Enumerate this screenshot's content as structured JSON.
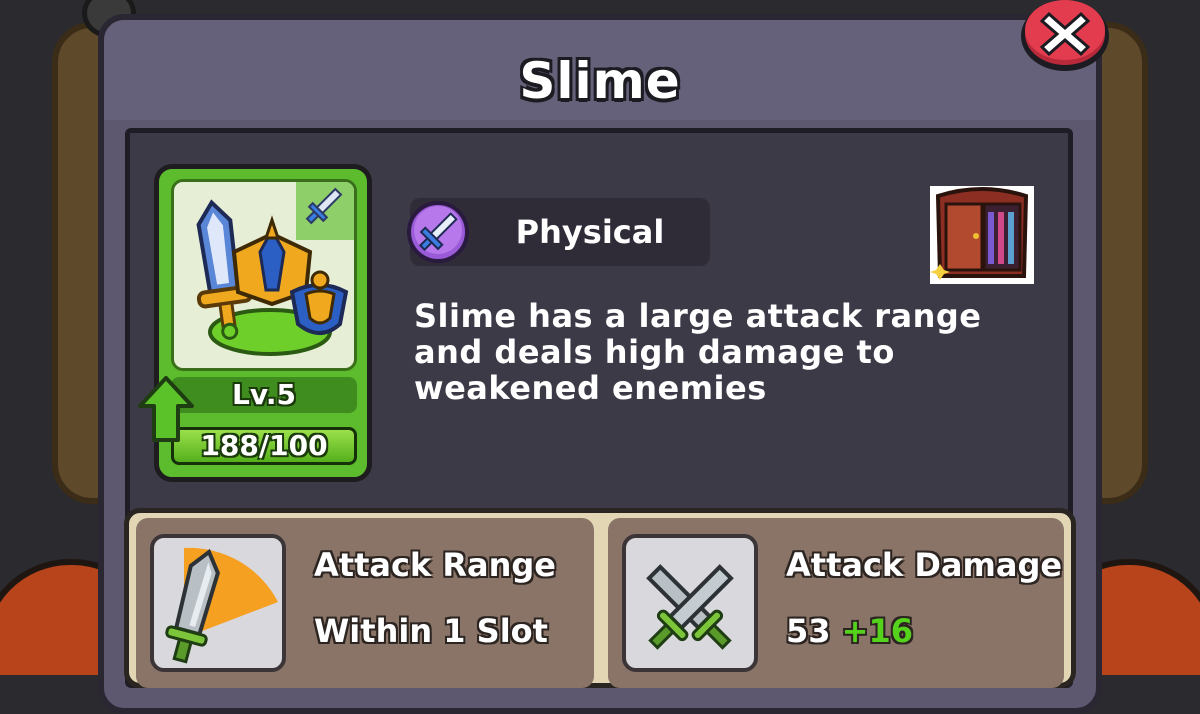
{
  "title": "Slime",
  "card": {
    "level": "Lv.5",
    "progress_text": "188/100",
    "progress_fraction": 1.0
  },
  "type": {
    "label": "Physical",
    "icon": "sword-icon"
  },
  "description": "Slime has a large attack range and deals high damage to weakened enemies",
  "stats": {
    "range": {
      "title": "Attack Range",
      "value": "Within 1 Slot",
      "icon": "sword-range-icon"
    },
    "damage": {
      "title": "Attack Damage",
      "value": "53",
      "bonus": "+16",
      "icon": "crossed-swords-icon"
    }
  },
  "colors": {
    "card_green": "#5cbc2e",
    "panel_purple": "#5d5870",
    "bonus_green": "#54d21c",
    "close_red": "#e23c4e",
    "range_orange": "#f5a020"
  }
}
